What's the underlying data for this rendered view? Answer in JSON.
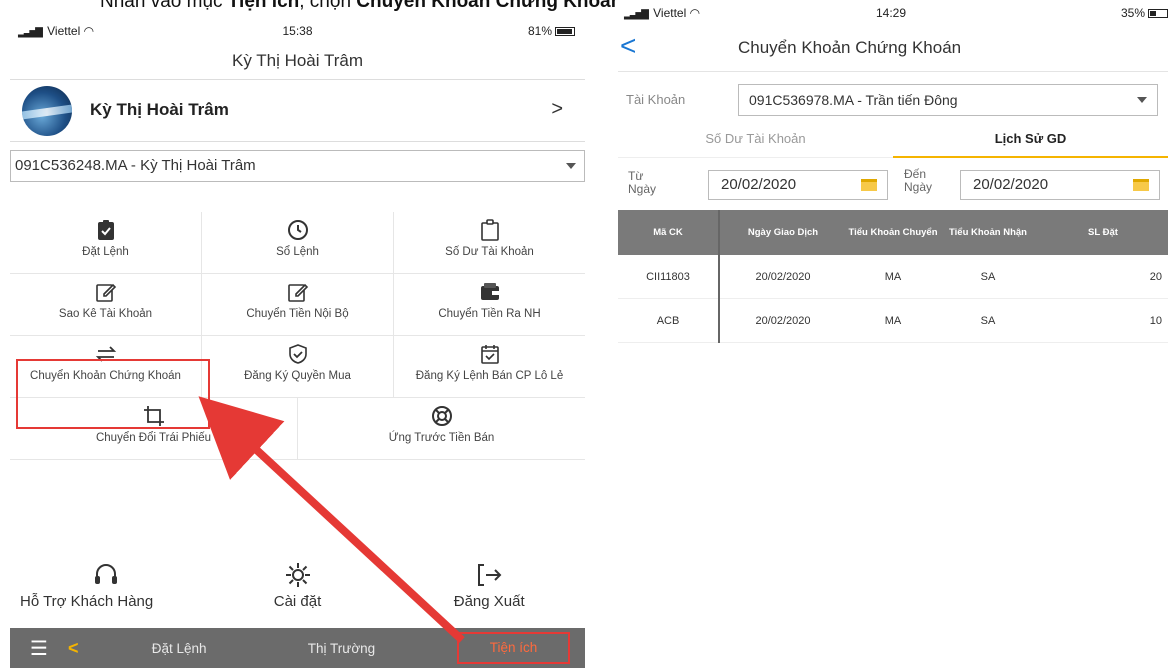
{
  "caption": {
    "prefix": "Nhấn vào mục ",
    "menu": "Tiện ích",
    "middle": ", chọn ",
    "item": "Chuyển Khoản Chứng Khoán"
  },
  "left": {
    "status": {
      "carrier": "Viettel",
      "time": "15:38",
      "battery": "81%"
    },
    "title": "Kỳ Thị Hoài Trâm",
    "profile_name": "Kỳ Thị Hoài Trâm",
    "account": "091C536248.MA - Kỳ Thị Hoài Trâm",
    "grid": [
      {
        "label": "Đặt Lệnh",
        "icon": "clipboard-check-icon"
      },
      {
        "label": "Sổ Lệnh",
        "icon": "clock-icon"
      },
      {
        "label": "Số Dư Tài Khoản",
        "icon": "clipboard-icon"
      },
      {
        "label": "Sao Kê Tài Khoản",
        "icon": "edit-icon"
      },
      {
        "label": "Chuyển Tiền Nội Bộ",
        "icon": "edit-icon"
      },
      {
        "label": "Chuyển Tiền Ra NH",
        "icon": "wallet-icon"
      },
      {
        "label": "Chuyển Khoản Chứng Khoán",
        "icon": "swap-icon"
      },
      {
        "label": "Đăng Ký Quyền Mua",
        "icon": "shield-check-icon"
      },
      {
        "label": "Đăng Ký Lệnh Bán CP Lô Lẻ",
        "icon": "calendar-check-icon"
      },
      {
        "label": "Chuyển Đổi Trái Phiếu",
        "icon": "crop-icon"
      },
      {
        "label": "Ứng Trước Tiền Bán",
        "icon": "lifebuoy-icon"
      }
    ],
    "actions": [
      {
        "label": "Hỗ Trợ Khách Hàng",
        "icon": "headset-icon"
      },
      {
        "label": "Cài đặt",
        "icon": "gear-icon"
      },
      {
        "label": "Đăng Xuất",
        "icon": "logout-icon"
      }
    ],
    "tabbar": {
      "tab1": "Đặt Lệnh",
      "tab2": "Thị Trường",
      "tab3": "Tiện ích"
    }
  },
  "right": {
    "status": {
      "carrier": "Viettel",
      "time": "14:29",
      "battery": "35%"
    },
    "title": "Chuyển Khoản Chứng Khoán",
    "account_label": "Tài Khoản",
    "account_value": "091C536978.MA - Trần tiến Đông",
    "tabs": [
      "Số Dư Tài Khoản",
      "Lịch Sử GD"
    ],
    "from_label_1": "Từ",
    "from_label_2": "Ngày",
    "from_value": "20/02/2020",
    "to_label_1": "Đến",
    "to_label_2": "Ngày",
    "to_value": "20/02/2020",
    "columns": [
      "Mã CK",
      "Ngày Giao Dịch",
      "Tiểu Khoản Chuyển",
      "Tiểu Khoản Nhận",
      "SL Đặt"
    ],
    "rows": [
      [
        "CII11803",
        "20/02/2020",
        "MA",
        "SA",
        "20"
      ],
      [
        "ACB",
        "20/02/2020",
        "MA",
        "SA",
        "10"
      ]
    ]
  },
  "colors": {
    "highlight": "#e53935",
    "arrow": "#e53935",
    "accent": "#f5b400",
    "link": "#1976d2",
    "tabbar": "#6b6b6b"
  }
}
